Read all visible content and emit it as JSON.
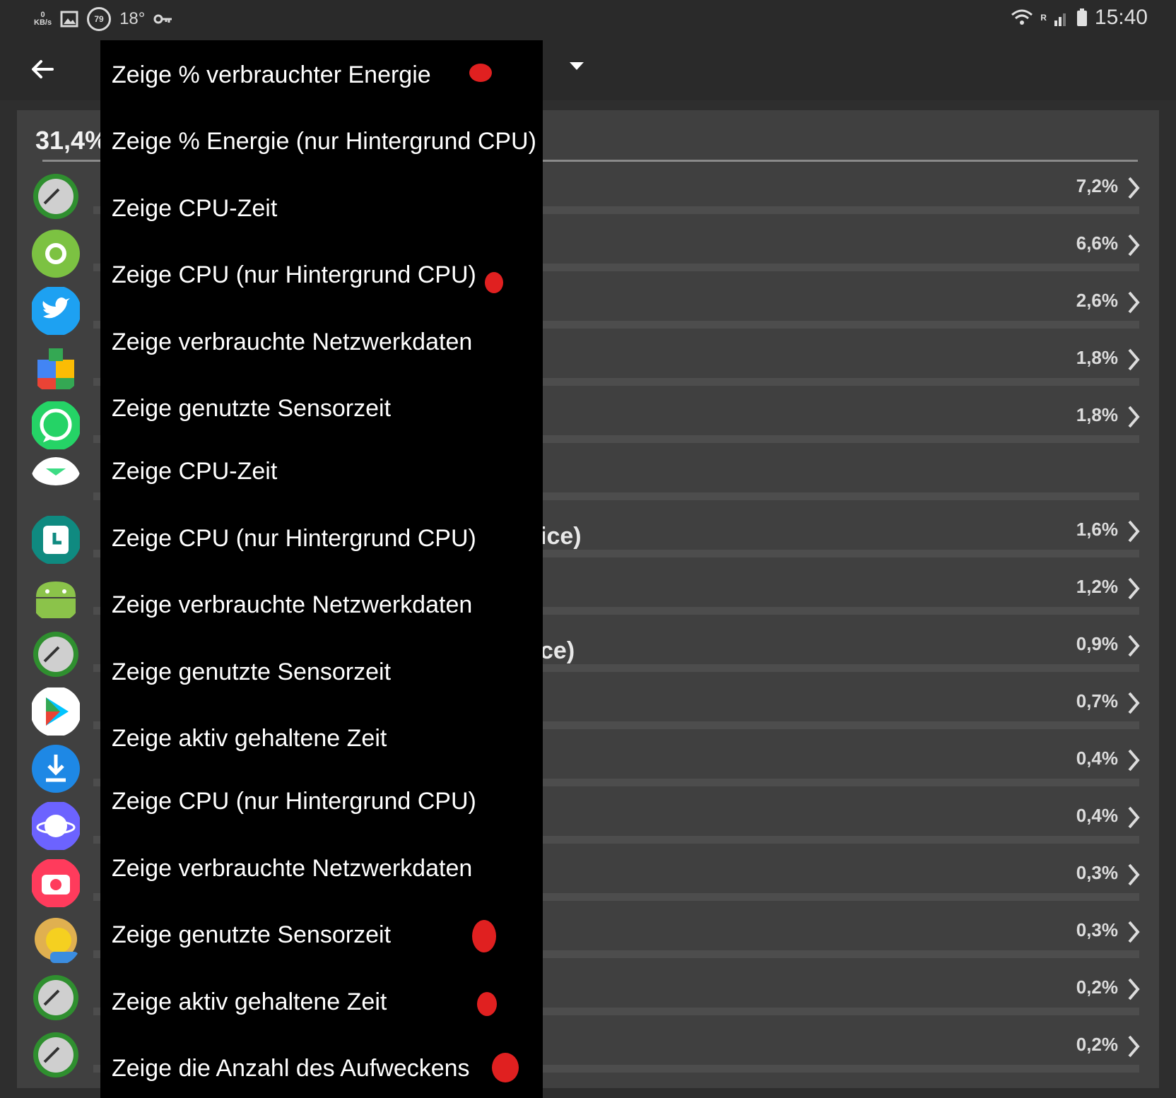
{
  "status_bar": {
    "kb_value": "0",
    "kb_unit": "KB/s",
    "temp_circle": "79",
    "temperature": "18°",
    "roaming": "R",
    "time": "15:40"
  },
  "header": {
    "back_icon": "arrow-left-icon",
    "dropdown_icon": "caret-down-icon"
  },
  "summary": {
    "total_percent": "31,4%"
  },
  "rows": [
    {
      "name_fragment": "",
      "percent": "7,2%",
      "icon": "gauge-icon"
    },
    {
      "name_fragment": "",
      "percent": "6,6%",
      "icon": "settings-icon"
    },
    {
      "name_fragment": "",
      "percent": "2,6%",
      "icon": "twitter-icon"
    },
    {
      "name_fragment": "",
      "percent": "1,8%",
      "icon": "play-services-icon"
    },
    {
      "name_fragment": "",
      "percent": "1,8%",
      "icon": "whatsapp-icon"
    },
    {
      "name_fragment": "",
      "percent": "",
      "icon": "android-round-icon"
    },
    {
      "name_fragment": "ice)",
      "percent": "1,6%",
      "icon": "clock-icon"
    },
    {
      "name_fragment": "",
      "percent": "1,2%",
      "icon": "android-icon"
    },
    {
      "name_fragment": "ce)",
      "percent": "0,9%",
      "icon": "gauge-icon"
    },
    {
      "name_fragment": "",
      "percent": "0,7%",
      "icon": "play-store-icon"
    },
    {
      "name_fragment": "",
      "percent": "0,4%",
      "icon": "download-icon"
    },
    {
      "name_fragment": "",
      "percent": "0,4%",
      "icon": "internet-icon"
    },
    {
      "name_fragment": "",
      "percent": "0,3%",
      "icon": "camera-icon"
    },
    {
      "name_fragment": "",
      "percent": "0,3%",
      "icon": "weather-pro-icon"
    },
    {
      "name_fragment": "",
      "percent": "0,2%",
      "icon": "gauge-icon"
    },
    {
      "name_fragment": "",
      "percent": "0,2%",
      "icon": "gauge-icon"
    }
  ],
  "menu": {
    "items": [
      {
        "label": "Zeige % verbrauchter Energie",
        "marked": true
      },
      {
        "label": "Zeige % Energie (nur Hintergrund CPU)",
        "marked": false
      },
      {
        "label": "Zeige CPU-Zeit",
        "marked": false
      },
      {
        "label": "Zeige CPU (nur Hintergrund CPU)",
        "marked": true
      },
      {
        "label": "Zeige verbrauchte Netzwerkdaten",
        "marked": false
      },
      {
        "label": "Zeige genutzte Sensorzeit",
        "marked": false
      },
      {
        "label": "Zeige CPU-Zeit",
        "marked": false
      },
      {
        "label": "Zeige CPU (nur Hintergrund CPU)",
        "marked": false
      },
      {
        "label": "Zeige verbrauchte Netzwerkdaten",
        "marked": false
      },
      {
        "label": "Zeige genutzte Sensorzeit",
        "marked": false
      },
      {
        "label": "Zeige aktiv gehaltene Zeit",
        "marked": false
      },
      {
        "label": "Zeige CPU (nur Hintergrund CPU)",
        "marked": false
      },
      {
        "label": "Zeige verbrauchte Netzwerkdaten",
        "marked": false
      },
      {
        "label": "Zeige genutzte Sensorzeit",
        "marked": true
      },
      {
        "label": "Zeige aktiv gehaltene Zeit",
        "marked": true
      },
      {
        "label": "Zeige die Anzahl des Aufweckens",
        "marked": true
      }
    ]
  },
  "colors": {
    "background": "#2e2e2e",
    "card": "#404040",
    "menu": "#000000",
    "mark": "#e02020"
  }
}
